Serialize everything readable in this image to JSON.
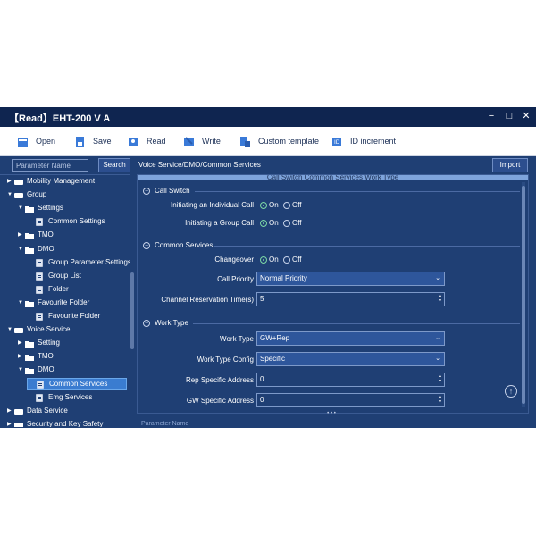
{
  "window": {
    "title": "【Read】EHT-200 V A",
    "minimize": "−",
    "maximize": "□",
    "close": "✕"
  },
  "toolbar": {
    "items": [
      {
        "label": "Open",
        "icon": "open-icon"
      },
      {
        "label": "Save",
        "icon": "save-icon"
      },
      {
        "label": "Read",
        "icon": "read-icon"
      },
      {
        "label": "Write",
        "icon": "write-icon"
      },
      {
        "label": "Custom template",
        "icon": "custom-template-icon"
      },
      {
        "label": "ID increment",
        "icon": "id-increment-icon"
      }
    ]
  },
  "search": {
    "placeholder": "Parameter Name",
    "button": "Search"
  },
  "tree": {
    "items": [
      {
        "label": "Mobility Management",
        "level": 0,
        "expand": "▶"
      },
      {
        "label": "Group",
        "level": 0,
        "expand": "▼"
      },
      {
        "label": "Settings",
        "level": 1,
        "expand": "▼"
      },
      {
        "label": "Common Settings",
        "level": 2,
        "expand": ""
      },
      {
        "label": "TMO",
        "level": 1,
        "expand": "▶"
      },
      {
        "label": "DMO",
        "level": 1,
        "expand": "▼"
      },
      {
        "label": "Group Parameter Settings",
        "level": 2,
        "expand": ""
      },
      {
        "label": "Group List",
        "level": 2,
        "expand": ""
      },
      {
        "label": "Folder",
        "level": 2,
        "expand": ""
      },
      {
        "label": "Favourite Folder",
        "level": 1,
        "expand": "▼"
      },
      {
        "label": "Favourite Folder",
        "level": 2,
        "expand": ""
      },
      {
        "label": "Voice Service",
        "level": 0,
        "expand": "▼"
      },
      {
        "label": "Setting",
        "level": 1,
        "expand": "▶"
      },
      {
        "label": "TMO",
        "level": 1,
        "expand": "▶"
      },
      {
        "label": "DMO",
        "level": 1,
        "expand": "▼"
      },
      {
        "label": "Common Services",
        "level": 2,
        "expand": "",
        "selected": true
      },
      {
        "label": "Emg Services",
        "level": 2,
        "expand": ""
      },
      {
        "label": "Data Service",
        "level": 0,
        "expand": "▶"
      },
      {
        "label": "Security and Key Safety",
        "level": 0,
        "expand": "▶"
      }
    ]
  },
  "main": {
    "breadcrumb": "Voice Service/DMO/Common Services",
    "import_button": "Import",
    "panel_header": "Call Switch  Common Services  Work Type",
    "sections": {
      "call_switch": {
        "title": "Call Switch",
        "collapse": "−"
      },
      "common_services": {
        "title": "Common Services",
        "collapse": "−"
      },
      "work_type": {
        "title": "Work Type",
        "collapse": "−"
      }
    },
    "fields": {
      "individual_call": {
        "label": "Initiating an Individual Call",
        "on": "On",
        "off": "Off",
        "value": "On"
      },
      "group_call": {
        "label": "Initiating a Group Call",
        "on": "On",
        "off": "Off",
        "value": "On"
      },
      "changeover": {
        "label": "Changeover",
        "on": "On",
        "off": "Off",
        "value": "On"
      },
      "call_priority": {
        "label": "Call Priority",
        "value": "Normal Priority"
      },
      "channel_reservation": {
        "label": "Channel Reservation Time(s)",
        "value": "5"
      },
      "work_type": {
        "label": "Work Type",
        "value": "GW+Rep"
      },
      "work_type_config": {
        "label": "Work Type Config",
        "value": "Specific"
      },
      "rep_address": {
        "label": "Rep Specific Address",
        "value": "0"
      },
      "gw_address": {
        "label": "GW Specific Address",
        "value": "0"
      }
    },
    "bottom_label": "Parameter Name",
    "grip": "• • •",
    "scroll_top": "↑"
  }
}
